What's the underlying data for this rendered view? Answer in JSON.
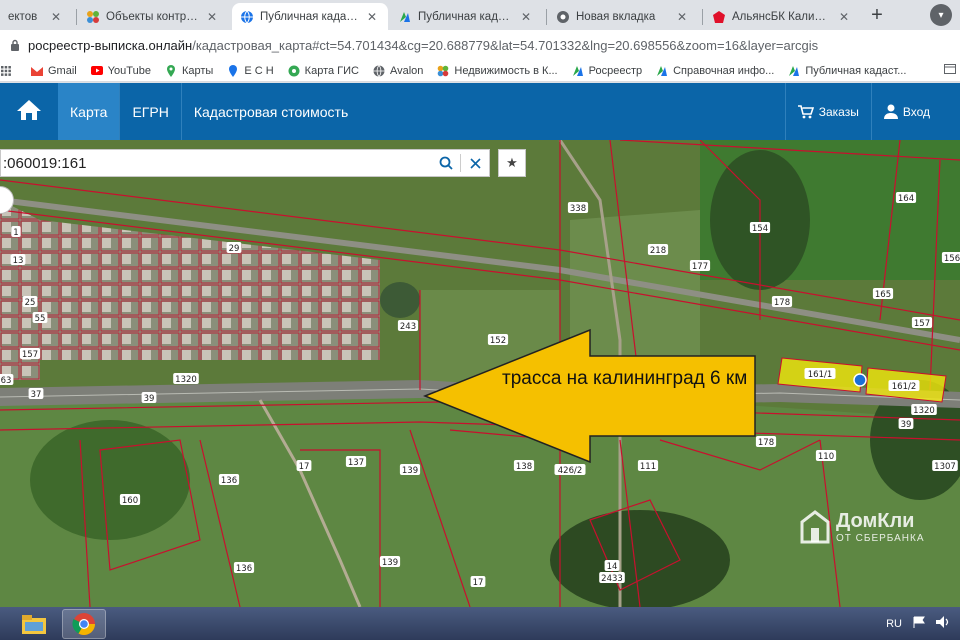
{
  "browser": {
    "tabs": [
      {
        "title": "ектов",
        "icon": "partial-tab-icon",
        "active": false
      },
      {
        "title": "Объекты контрагента",
        "icon": "flower-icon",
        "active": false
      },
      {
        "title": "Публичная кадастрова",
        "icon": "globe-icon",
        "active": true
      },
      {
        "title": "Публичная кадастров",
        "icon": "cadastral-logo-icon",
        "active": false
      },
      {
        "title": "Новая вкладка",
        "icon": "chrome-icon",
        "active": false
      },
      {
        "title": "АльянсБК Калинингра",
        "icon": "red-pentagon-icon",
        "active": false
      }
    ],
    "url_host": "росреестр-выписка.онлайн",
    "url_path": "/кадастровая_карта#ct=54.701434&cg=20.688779&lat=54.701332&lng=20.698556&zoom=16&layer=arcgis",
    "bookmarks": [
      {
        "label": "Gmail",
        "icon": "gmail-icon"
      },
      {
        "label": "YouTube",
        "icon": "youtube-icon"
      },
      {
        "label": "Карты",
        "icon": "maps-pin-icon"
      },
      {
        "label": "Е С Н",
        "icon": "location-icon"
      },
      {
        "label": "Карта ГИС",
        "icon": "gis-icon"
      },
      {
        "label": "Avalon",
        "icon": "globe-icon"
      },
      {
        "label": "Недвижимость в К...",
        "icon": "flower-icon"
      },
      {
        "label": "Росреестр",
        "icon": "cadastral-logo-icon"
      },
      {
        "label": "Справочная инфо...",
        "icon": "cadastral-logo-icon"
      },
      {
        "label": "Публичная кадаст...",
        "icon": "cadastral-logo-icon"
      }
    ]
  },
  "site": {
    "nav": [
      {
        "label": "Карта",
        "active": true
      },
      {
        "label": "ЕГРН",
        "active": false
      },
      {
        "label": "Кадастровая стоимость",
        "active": false
      }
    ],
    "orders_label": "Заказы",
    "login_label": "Вход",
    "search_value": ":060019:161"
  },
  "map": {
    "annotation_text": "трасса на калининград 6 км",
    "highlighted_parcels": [
      "161/1",
      "161/2"
    ],
    "parcel_labels": [
      "338",
      "218",
      "177",
      "164",
      "154",
      "178",
      "165",
      "156",
      "157",
      "152",
      "243",
      "1320",
      "39",
      "37",
      "137",
      "139",
      "138",
      "17",
      "136",
      "160",
      "110",
      "426/2",
      "111",
      "14",
      "2433",
      "1307",
      "29",
      "1",
      "13",
      "25",
      "55",
      "63",
      "157",
      "178",
      "161/1",
      "161/2",
      "1320",
      "39",
      "136",
      "139",
      "17"
    ],
    "watermark_main": "ДомКли",
    "watermark_sub": "ОТ СБЕРБАНКА"
  },
  "taskbar": {
    "lang": "RU"
  },
  "colors": {
    "header_blue": "#0b65a8",
    "parcel_outline": "#c8102e",
    "highlight_yellow": "#f2e80c",
    "arrow_yellow": "#f5c000"
  }
}
